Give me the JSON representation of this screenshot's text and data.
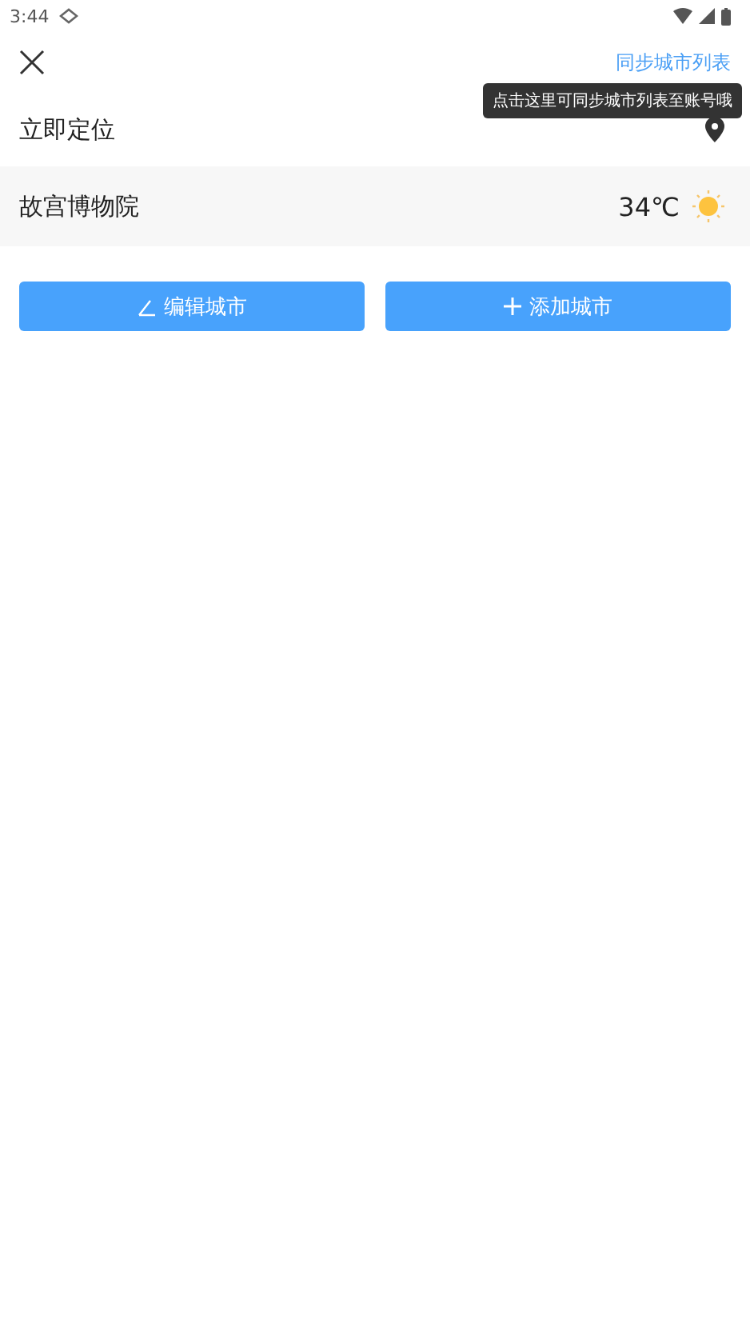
{
  "status_bar": {
    "time": "3:44"
  },
  "header": {
    "sync_link": "同步城市列表",
    "tooltip": "点击这里可同步城市列表至账号哦"
  },
  "locate_row": {
    "label": "立即定位"
  },
  "cities": [
    {
      "name": "故宫博物院",
      "temperature": "34℃",
      "kind": "sunny"
    }
  ],
  "buttons": [
    {
      "label": "编辑城市",
      "kind": "edit"
    },
    {
      "label": "添加城市",
      "kind": "add"
    }
  ]
}
